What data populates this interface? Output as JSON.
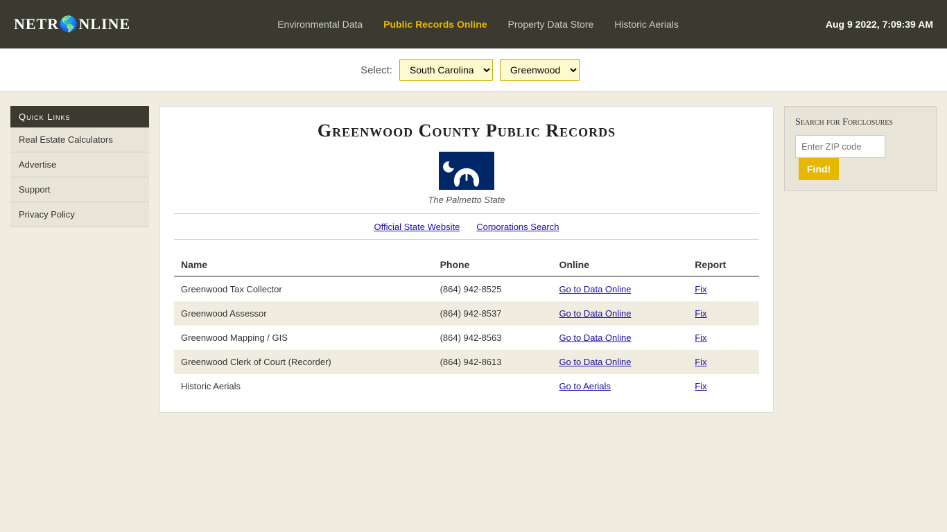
{
  "header": {
    "logo": "NETRONLINE",
    "logo_globe": "🌐",
    "nav": [
      {
        "label": "Environmental Data",
        "active": false
      },
      {
        "label": "Public Records Online",
        "active": true
      },
      {
        "label": "Property Data Store",
        "active": false
      },
      {
        "label": "Historic Aerials",
        "active": false
      }
    ],
    "datetime": "Aug 9 2022, 7:09:39 AM"
  },
  "selector": {
    "label": "Select:",
    "state_selected": "South Carolina",
    "county_selected": "Greenwood",
    "states": [
      "South Carolina"
    ],
    "counties": [
      "Greenwood"
    ]
  },
  "sidebar": {
    "title": "Quick Links",
    "links": [
      "Real Estate Calculators",
      "Advertise",
      "Support",
      "Privacy Policy"
    ]
  },
  "main": {
    "title": "Greenwood County Public Records",
    "flag_caption": "The Palmetto State",
    "state_links": [
      {
        "label": "Official State Website",
        "href": "#"
      },
      {
        "label": "Corporations Search",
        "href": "#"
      }
    ],
    "table_headers": [
      "Name",
      "Phone",
      "Online",
      "Report"
    ],
    "table_rows": [
      {
        "name": "Greenwood Tax Collector",
        "phone": "(864) 942-8525",
        "online_label": "Go to Data Online",
        "report_label": "Fix"
      },
      {
        "name": "Greenwood Assessor",
        "phone": "(864) 942-8537",
        "online_label": "Go to Data Online",
        "report_label": "Fix"
      },
      {
        "name": "Greenwood Mapping / GIS",
        "phone": "(864) 942-8563",
        "online_label": "Go to Data Online",
        "report_label": "Fix"
      },
      {
        "name": "Greenwood Clerk of Court (Recorder)",
        "phone": "(864) 942-8613",
        "online_label": "Go to Data Online",
        "report_label": "Fix"
      },
      {
        "name": "Historic Aerials",
        "phone": "",
        "online_label": "Go to Aerials",
        "report_label": "Fix"
      }
    ]
  },
  "foreclosure": {
    "title": "Search for Forclosures",
    "zip_placeholder": "Enter ZIP code",
    "button_label": "Find!"
  }
}
